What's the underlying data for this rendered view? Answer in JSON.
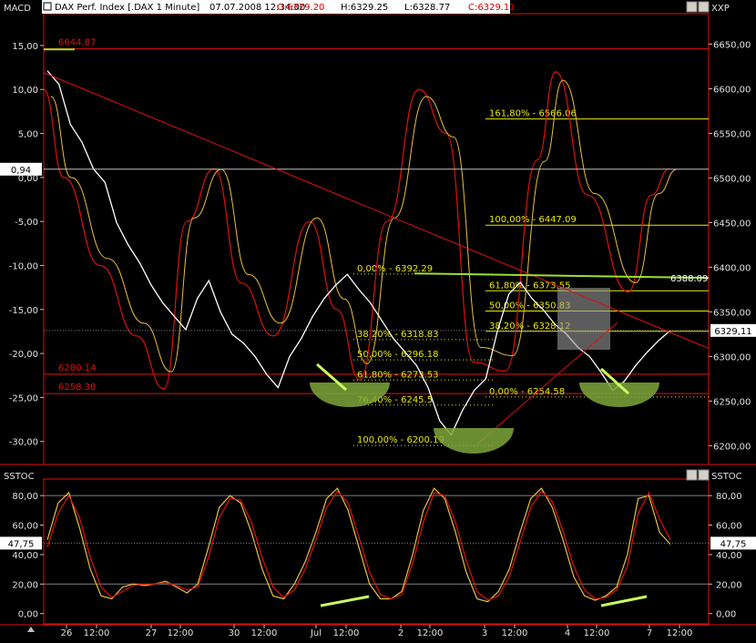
{
  "chart_data": [
    {
      "type": "line",
      "title": "DAX Perf. Index [.DAX 1 Minute]",
      "header": {
        "date_time": "07.07.2008 12:34:00",
        "open": "O:6329.20",
        "high": "H:6329.25",
        "low": "L:6328.77",
        "close": "C:6329.11"
      },
      "left_axis_label": "MACD",
      "right_axis_label": "XXP",
      "left_ticks": [
        "15,00",
        "10,00",
        "5,00",
        "0,00",
        "-5,00",
        "-10,00",
        "-15,00",
        "-20,00",
        "-25,00",
        "-30,00"
      ],
      "left_tick_values": [
        15,
        10,
        5,
        0,
        -5,
        -10,
        -15,
        -20,
        -25,
        -30
      ],
      "right_ticks": [
        "6650,00",
        "6600,00",
        "6550,00",
        "6500,00",
        "6450,00",
        "6400,00",
        "6350,00",
        "6300,00",
        "6250,00",
        "6200,00"
      ],
      "right_tick_values": [
        6650,
        6600,
        6550,
        6500,
        6450,
        6400,
        6350,
        6300,
        6250,
        6200
      ],
      "price_range": [
        6183,
        6680
      ],
      "macd_range": [
        -32.2,
        18.2
      ],
      "current_price_label": "6329,11",
      "current_price": 6329.11,
      "macd_value_label": "0,94",
      "macd_value": 0.94,
      "horizontal_levels": [
        {
          "label": "6644.87",
          "price": 6644.87,
          "color": "#e01010"
        },
        {
          "label": "6280.14",
          "price": 6280.14,
          "color": "#e01010"
        },
        {
          "label": "6258.38",
          "price": 6258.38,
          "color": "#e01010"
        }
      ],
      "fib_sets": [
        {
          "color": "#e8e800",
          "levels": [
            {
              "label": "0,00% - 6392.29",
              "price": 6392.29
            },
            {
              "label": "38,20% - 6318.83",
              "price": 6318.83
            },
            {
              "label": "50,00% - 6296.18",
              "price": 6296.18
            },
            {
              "label": "61,80% - 6273.53",
              "price": 6273.53
            },
            {
              "label": "76,40% - 6245.5",
              "price": 6245.5
            },
            {
              "label": "100,00% - 6200.19",
              "price": 6200.19
            }
          ]
        },
        {
          "color": "#e8e800",
          "levels": [
            {
              "label": "161,80% - 6566.06",
              "price": 6566.06
            },
            {
              "label": "100,00% - 6447.09",
              "price": 6447.09
            },
            {
              "label": "61,80% - 6373.55",
              "price": 6373.55
            },
            {
              "label": "50,00% - 6350.83",
              "price": 6350.83
            },
            {
              "label": "38,20% - 6328.12",
              "price": 6328.12
            },
            {
              "label": "0,00% - 6254.58",
              "price": 6254.58
            }
          ]
        }
      ],
      "trendline_label": "6388.09",
      "trendline_price": 6388.09,
      "price_series": [
        6620,
        6605,
        6560,
        6540,
        6510,
        6495,
        6450,
        6425,
        6405,
        6380,
        6360,
        6345,
        6330,
        6365,
        6385,
        6350,
        6325,
        6315,
        6300,
        6280,
        6265,
        6300,
        6320,
        6345,
        6365,
        6380,
        6392,
        6375,
        6360,
        6340,
        6320,
        6305,
        6290,
        6265,
        6228,
        6212,
        6240,
        6262,
        6275,
        6328,
        6370,
        6383,
        6365,
        6352,
        6336,
        6325,
        6310,
        6300,
        6282,
        6262,
        6272,
        6290,
        6305,
        6318,
        6329
      ]
    },
    {
      "type": "line",
      "left_axis_label": "SSTOC",
      "right_axis_label": "SSTOC",
      "range": [
        -7,
        90
      ],
      "left_ticks": [
        "80,00",
        "60,00",
        "40,00",
        "20,00",
        "0,00"
      ],
      "right_ticks": [
        "80,00",
        "60,00",
        "40,00",
        "20,00",
        "0,00"
      ],
      "tick_values": [
        80,
        60,
        40,
        20,
        0
      ],
      "reference_lines": [
        80,
        20
      ],
      "current_value_label": "47,75",
      "current_value": 47.75,
      "series": [
        {
          "color": "#e8c040",
          "values": [
            50,
            75,
            82,
            58,
            30,
            12,
            10,
            18,
            20,
            19,
            20,
            22,
            18,
            14,
            20,
            45,
            72,
            80,
            75,
            55,
            30,
            12,
            10,
            20,
            35,
            55,
            78,
            85,
            70,
            45,
            20,
            10,
            10,
            15,
            40,
            70,
            85,
            78,
            55,
            28,
            10,
            8,
            15,
            30,
            55,
            78,
            85,
            72,
            50,
            25,
            12,
            9,
            12,
            18,
            40,
            78,
            80,
            55,
            47
          ]
        },
        {
          "color": "#e01010",
          "values": [
            45,
            68,
            80,
            65,
            38,
            18,
            11,
            15,
            19,
            20,
            20,
            21,
            19,
            16,
            18,
            38,
            65,
            78,
            77,
            62,
            38,
            18,
            11,
            16,
            30,
            50,
            72,
            83,
            75,
            52,
            28,
            13,
            10,
            13,
            34,
            62,
            82,
            80,
            62,
            36,
            15,
            9,
            12,
            25,
            48,
            72,
            83,
            76,
            56,
            32,
            16,
            10,
            11,
            16,
            32,
            68,
            82,
            64,
            50
          ]
        }
      ]
    }
  ],
  "x_axis": {
    "labels": [
      "26",
      "12:00",
      "27",
      "12:00",
      "30",
      "12:00",
      "Jul",
      "12:00",
      "2",
      "12:00",
      "3",
      "12:00",
      "4",
      "12:00",
      "7",
      "12:00"
    ]
  },
  "colors": {
    "red": "#e01010",
    "yellow": "#e8e800",
    "trend_green": "#9ce030",
    "ellipse_green": "#7ea63b",
    "highlight_green": "#c8ff60"
  },
  "icons": [
    "pin-icon",
    "restore-icon",
    "close-icon"
  ]
}
